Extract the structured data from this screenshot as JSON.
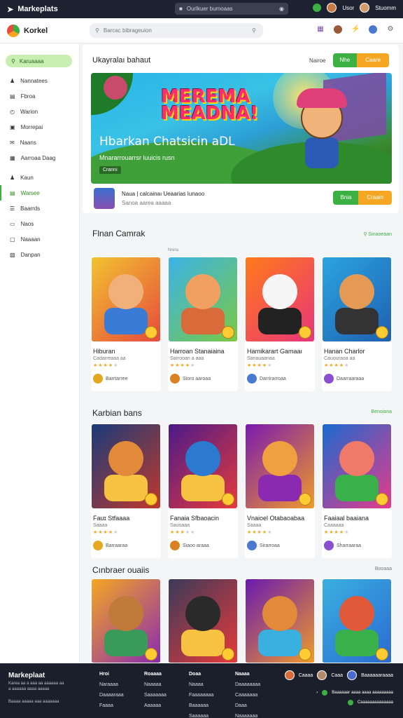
{
  "topbar": {
    "brand": "Markeplats",
    "search_placeholder": "Ourlkuer bumoaas",
    "user": "Usor",
    "account": "Stuomm"
  },
  "header": {
    "logo": "Korkel",
    "search_placeholder": "Barcac bibrageuion"
  },
  "sidebar": {
    "active": "Karuaaaa",
    "items": [
      {
        "label": "Nannatees",
        "icon": "user-icon"
      },
      {
        "label": "Fbroa",
        "icon": "doc-icon"
      },
      {
        "label": "Warion",
        "icon": "clock-icon"
      },
      {
        "label": "Morrepai",
        "icon": "folder-icon"
      },
      {
        "label": "Naans",
        "icon": "mail-icon"
      },
      {
        "label": "Aarroaa Daag",
        "icon": "grid-icon"
      }
    ],
    "items2": [
      {
        "label": "Kaun",
        "icon": "people-icon",
        "green": false
      },
      {
        "label": "Warsee",
        "icon": "stack-icon",
        "green": true
      },
      {
        "label": "Baarrds",
        "icon": "list-icon",
        "green": false
      },
      {
        "label": "Naos",
        "icon": "monitor-icon",
        "green": false
      },
      {
        "label": "Naaaan",
        "icon": "box-icon",
        "green": false
      },
      {
        "label": "Danpan",
        "icon": "calendar-icon",
        "green": false
      }
    ]
  },
  "hero": {
    "section_title": "Ukayralaı bahaut",
    "link": "Nairoe",
    "btn_green": "Nhe",
    "btn_orange": "Caare",
    "banner_logo_line1": "MEREMA",
    "banner_logo_line2": "MEADNA!",
    "banner_title": "Hbarkan Chatsicin aDL",
    "banner_sub": "Mnararrouarrsr luuicis rusn",
    "banner_tag": "Cranni",
    "dev_name": "Naua | calcainaı Ueaarias Iunaoo",
    "dev_meta": "Sanoa aarea aaaaa",
    "btn2_green": "Bnia",
    "btn2_orange": "Craain"
  },
  "sections": [
    {
      "title": "Flnan Camrak",
      "link": "Sinaoeaan",
      "sub": "Nrera",
      "cards": [
        {
          "title": "Hiburan",
          "sub": "Cadarreaaa aa",
          "stars": 4,
          "dev": "Barrtarree"
        },
        {
          "title": "Harroan Stanaiaina",
          "sub": "Sarrooan a aaa",
          "stars": 4,
          "dev": "Sioro aaroaa"
        },
        {
          "title": "Harnikarart Gamaaı",
          "sub": "Sanauaanaa",
          "stars": 4,
          "dev": "Darrirarroaa"
        },
        {
          "title": "Hanan Charlor",
          "sub": "Cauouraoa aa",
          "stars": 4,
          "dev": "Daarraaraaa"
        }
      ]
    },
    {
      "title": "Karbian bans",
      "link": "Benoiana",
      "sub": "",
      "cards": [
        {
          "title": "Fauɪ Stfaaaa",
          "sub": "Saaaa",
          "stars": 4,
          "dev": "Barraaraa"
        },
        {
          "title": "Fanaia Sfbaoacin",
          "sub": "Sauoaaa",
          "stars": 3,
          "dev": "Siaoo araaa"
        },
        {
          "title": "Vnaioel Otabaoabaa",
          "sub": "Saaaa",
          "stars": 4,
          "dev": "Sirarroaa"
        },
        {
          "title": "Faaiaal baaiana",
          "sub": "Caaaaaa",
          "stars": 4,
          "dev": "Sharraaraa"
        }
      ]
    },
    {
      "title": "Cınbraer ouaiis",
      "link": "Booaaa",
      "sub": "",
      "cards": []
    }
  ],
  "footer": {
    "brand": "Markeplaat",
    "line1": "Karea aa a aaa aa aaaaaa aa",
    "line2": "a aaaaaa aaaa aaaaa",
    "line3": "Baaaa aaaaa aaa aaaaaaa",
    "col1": [
      "Hroi",
      "Naraaaa",
      "Daaaaraaa",
      "Faaaa"
    ],
    "col2": [
      "Roaaaa",
      "Naaaaa",
      "Saaaaaaa",
      "Aaaaaa"
    ],
    "col3": [
      "Doaa",
      "Naaaa",
      "Faaaaaaaa",
      "Baaaaaa",
      "Saaaaaa"
    ],
    "col4": [
      "Naaaa",
      "Daaaaaaaa",
      "Caaaaaaa",
      "Daaa",
      "Naaaaaaa"
    ],
    "right_user1": "Caaaa",
    "right_user2": "Caaa",
    "right_user3": "Baaaaaaraaaa",
    "right_line2": "Baaaaaar aaaa aaaa aaaaaaaaa",
    "right_line3": "Caaaaaaaaaaaaaa"
  }
}
